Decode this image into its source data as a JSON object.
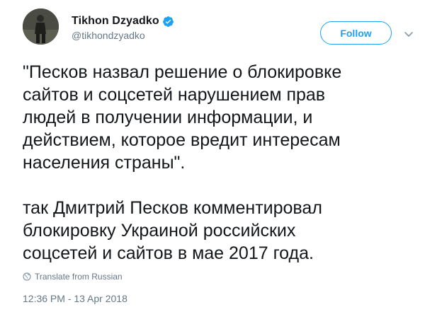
{
  "author": {
    "display_name": "Tikhon Dzyadko",
    "handle": "@tikhondzyadko",
    "verified": true
  },
  "follow_label": "Follow",
  "tweet": {
    "paragraphs": [
      "\"Песков назвал решение о блокировке\nсайтов и соцсетей нарушением прав\nлюдей в получении информации, и\nдействием, которое вредит интересам\nнаселения страны\".",
      "так Дмитрий Песков комментировал\nблокировку Украиной российских\nсоцсетей и сайтов в мае 2017 года."
    ]
  },
  "translate_label": "Translate from Russian",
  "timestamp": "12:36 PM - 13 Apr 2018",
  "colors": {
    "accent": "#1da1f2",
    "text": "#14171a",
    "secondary": "#657786"
  },
  "icons": {
    "verified": "verified-badge-icon",
    "caret": "chevron-down-icon",
    "translate": "globe-icon"
  }
}
